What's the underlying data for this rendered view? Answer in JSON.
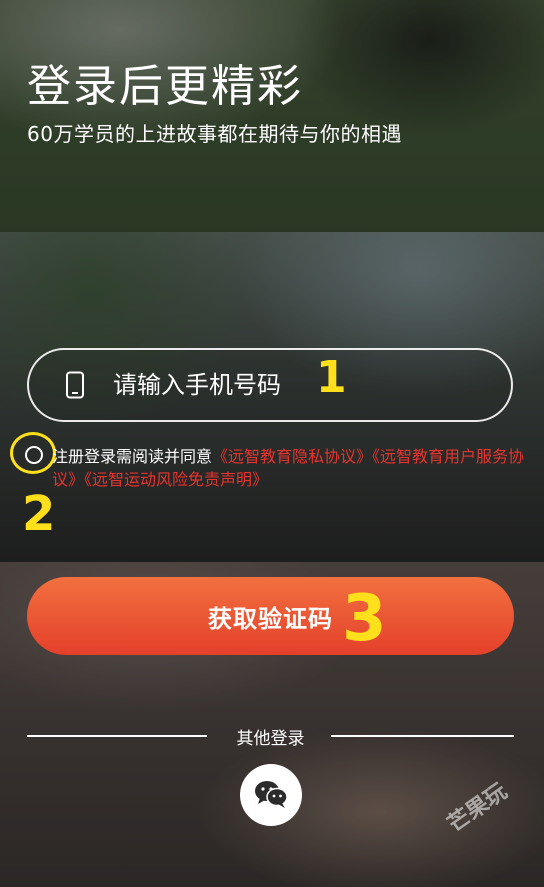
{
  "header": {
    "title": "登录后更精彩",
    "subtitle": "60万学员的上进故事都在期待与你的相遇"
  },
  "form": {
    "phone_placeholder": "请输入手机号码",
    "agreement": {
      "prefix": "注册登录需阅读并同意",
      "links": [
        "《远智教育隐私协议》",
        "《远智教育用户服务协议》",
        "《远智运动风险免责声明》"
      ],
      "link_color": "#e8332e",
      "checked": false
    },
    "submit_label": "获取验证码"
  },
  "other_login": {
    "label": "其他登录",
    "icon": "wechat-icon"
  },
  "annotations": [
    "1",
    "2",
    "3"
  ],
  "watermark": "芒果玩",
  "colors": {
    "accent_gradient_top": "#f2703f",
    "accent_gradient_bottom": "#e4402a",
    "annotation": "#ffe01a"
  }
}
